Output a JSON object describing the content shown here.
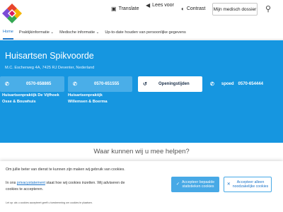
{
  "header": {
    "translate": "Translate",
    "read_aloud": "Lees voor",
    "contrast": "Contrast",
    "dossier_button": "Mijn medisch dossier"
  },
  "nav": [
    {
      "label": "Home"
    },
    {
      "label": "Praktijkinformatie ⌄"
    },
    {
      "label": "Medische informatie ⌄"
    },
    {
      "label": "Up-to-date houden van persoonlijke gegevens"
    }
  ],
  "hero": {
    "title": "Huisartsen Spikvoorde",
    "address": "M.C. Escherweg 4A, 7425 RJ Deventer, Nederland",
    "phone1": "0570-658865",
    "phone2": "0570-651555",
    "hours_button": "Openingstijden",
    "spoed_label": "spoed",
    "spoed_number": "0570-654444",
    "practice1_line1": "Huisartsenpraktijk De Vijfhoek",
    "practice1_line2": "Osse & Bouwhuis",
    "practice2_line1": "Huisartsenpraktijk",
    "practice2_line2": "Willemsen & Boerma"
  },
  "help_heading": "Waar kunnen wij u mee helpen?",
  "cookie": {
    "line1": "Om jullie beter van dienst te kunnen zijn maken wij gebruik van cookies.",
    "line2_pre": "In ons ",
    "line2_link": "privacystatement",
    "line2_post": " staat hoe wij cookies inzetten. Wij adviseren de",
    "line3": "cookies te accepteren.",
    "line4": "Let op: als u cookies accepteert geeft u toestemming om cookies te plaatsen.",
    "accept_button_line1": "Accepteer bepaalde",
    "accept_button_line2": "statistieken cookies",
    "necessary_button_line1": "Accepteer alleen",
    "necessary_button_line2": "noodzakelijke cookies"
  },
  "colors": {
    "hero_blue": "#1696e0",
    "card_blue": "#4aaee8",
    "link_blue": "#1a73c8"
  }
}
